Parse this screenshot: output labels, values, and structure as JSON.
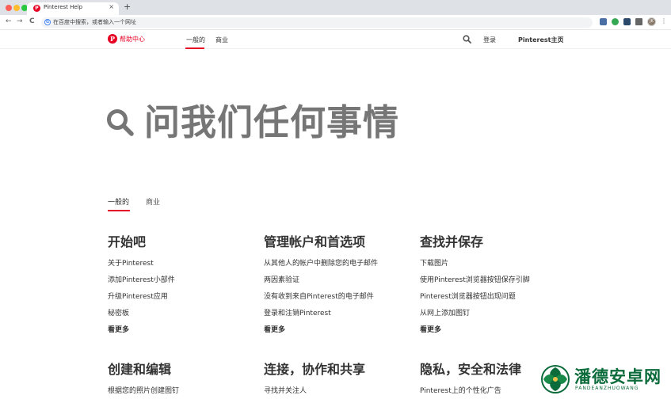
{
  "browser": {
    "tab_title": "Pinterest Help",
    "tab_close": "×",
    "new_tab": "+",
    "nav_back": "←",
    "nav_forward": "→",
    "nav_reload": "C",
    "address_placeholder": "在百度中搜索，或者输入一个网址",
    "profile_initials": "JK",
    "menu": "⋮"
  },
  "header": {
    "brand_letter": "P",
    "brand": "帮助中心",
    "nav_general": "一般的",
    "nav_business": "商业",
    "login": "登录",
    "home": "Pinterest主页"
  },
  "hero": {
    "title": "问我们任何事情"
  },
  "sub_tabs": {
    "general": "一般的",
    "business": "商业"
  },
  "columns": [
    {
      "title": "开始吧",
      "links": [
        "关于Pinterest",
        "添加Pinterest小部件",
        "升级Pinterest应用",
        "秘密板"
      ],
      "more": "看更多"
    },
    {
      "title": "管理帐户和首选项",
      "links": [
        "从其他人的帐户中删除您的电子邮件",
        "两因素验证",
        "没有收到来自Pinterest的电子邮件",
        "登录和注销Pinterest"
      ],
      "more": "看更多"
    },
    {
      "title": "查找并保存",
      "links": [
        "下载图片",
        "使用Pinterest浏览器按钮保存引脚",
        "Pinterest浏览器按钮出现问题",
        "从网上添加图钉"
      ],
      "more": "看更多"
    },
    {
      "title": "创建和编辑",
      "links": [
        "根据您的照片创建图钉"
      ]
    },
    {
      "title": "连接，协作和共享",
      "links": [
        "寻找并关注人"
      ]
    },
    {
      "title": "隐私，安全和法律",
      "links": [
        "Pinterest上的个性化广告"
      ]
    }
  ],
  "watermark": {
    "name": "潘德安卓网",
    "sub": "PANDEANZHUOWANG"
  },
  "colors": {
    "accent": "#e60023",
    "text": "#333333",
    "hero_gray": "#767676",
    "watermark_green": "#0b6b3a"
  }
}
